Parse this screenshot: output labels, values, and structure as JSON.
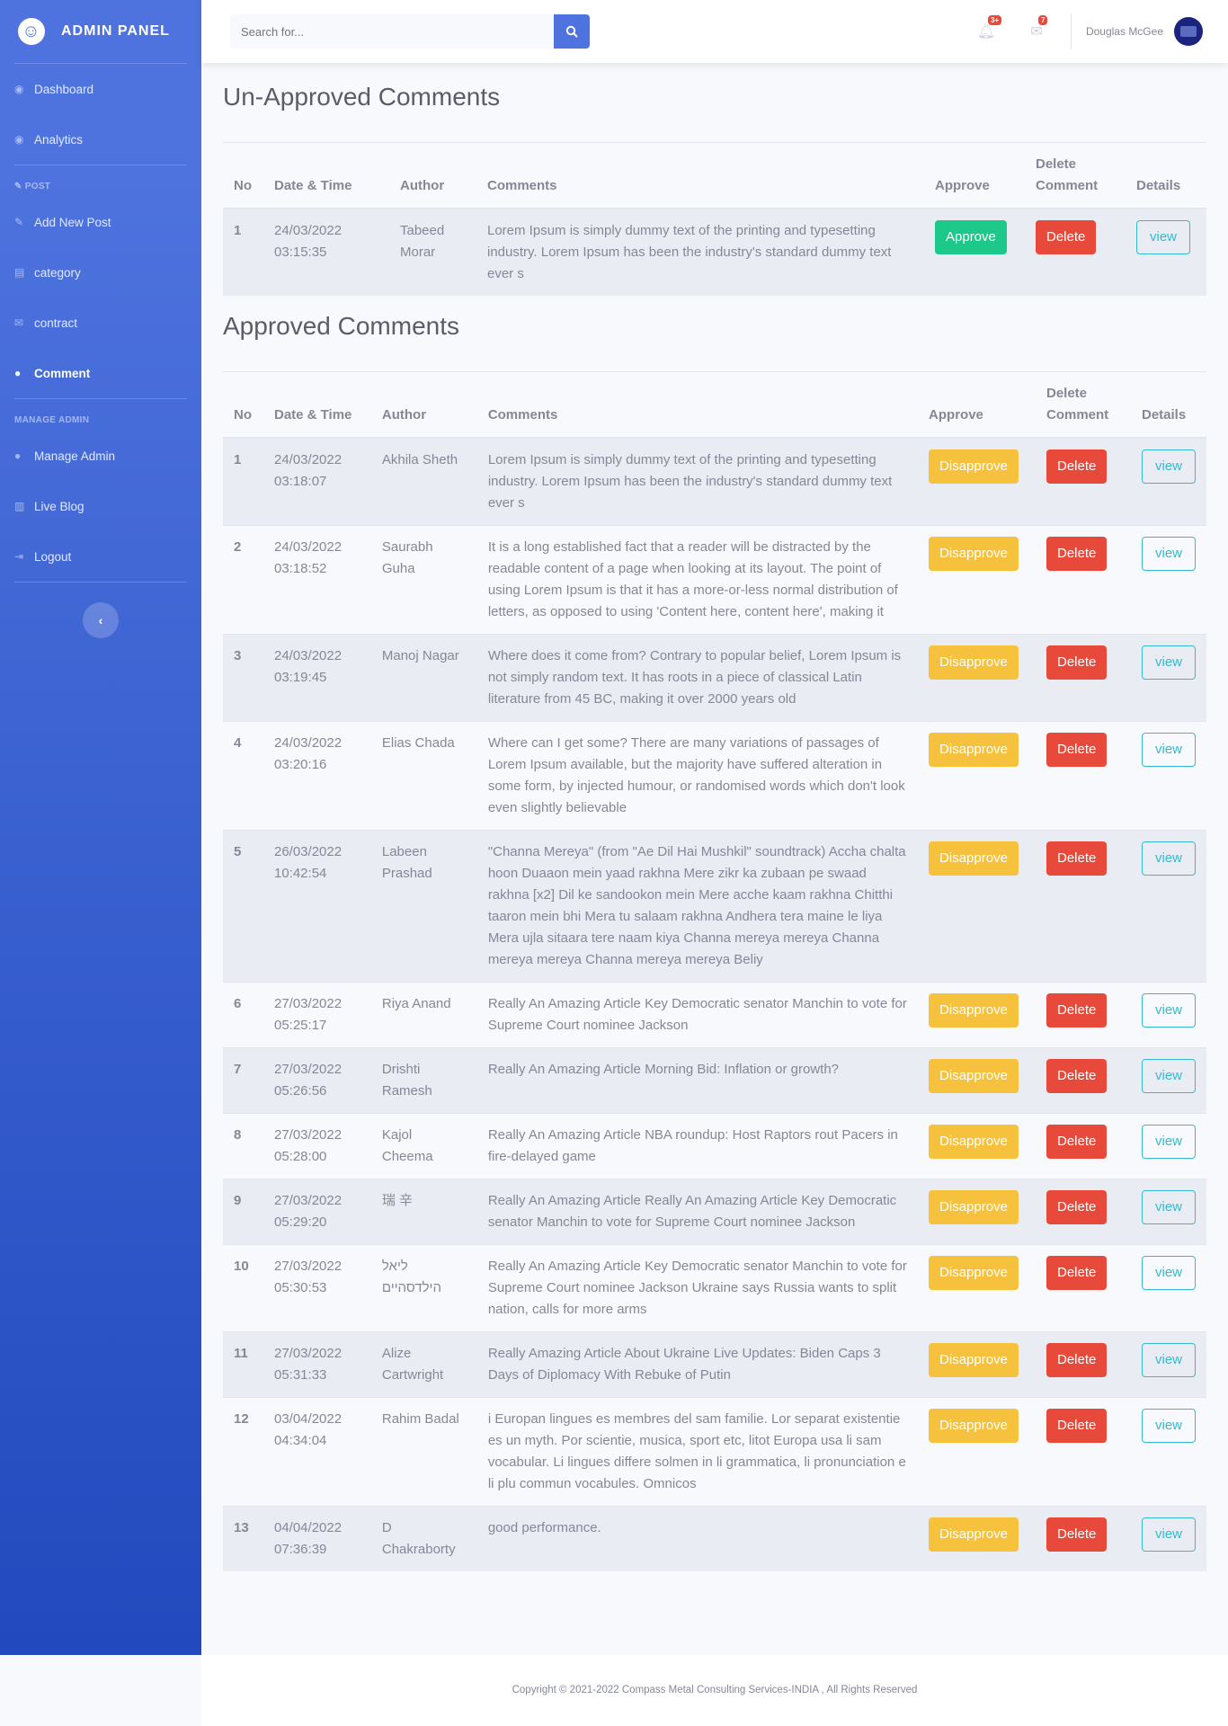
{
  "brand": {
    "title": "ADMIN PANEL"
  },
  "sidebar": {
    "items_top": [
      {
        "label": "Dashboard",
        "icon": "dashboard-icon"
      },
      {
        "label": "Analytics",
        "icon": "analytics-icon"
      }
    ],
    "heading_post": "POST",
    "items_post": [
      {
        "label": "Add New Post",
        "icon": "pen-icon"
      },
      {
        "label": "category",
        "icon": "list-icon"
      },
      {
        "label": "contract",
        "icon": "envelope-icon"
      },
      {
        "label": "Comment",
        "icon": "comment-icon"
      }
    ],
    "heading_admin": "MANAGE ADMIN",
    "items_admin": [
      {
        "label": "Manage Admin",
        "icon": "user-icon"
      },
      {
        "label": "Live Blog",
        "icon": "chart-icon"
      },
      {
        "label": "Logout",
        "icon": "logout-icon"
      }
    ],
    "active": "Comment"
  },
  "topbar": {
    "search_placeholder": "Search for...",
    "alerts_count": "3+",
    "messages_count": "7",
    "user_name": "Douglas McGee"
  },
  "unapproved": {
    "title": "Un-Approved Comments",
    "headers": {
      "no": "No",
      "date": "Date & Time",
      "author": "Author",
      "comments": "Comments",
      "approve": "Approve",
      "delete": "Delete Comment",
      "details": "Details"
    },
    "approve_label": "Approve",
    "delete_label": "Delete",
    "view_label": "view",
    "rows": [
      {
        "no": "1",
        "date": "24/03/2022 03:15:35",
        "author": "Tabeed Morar",
        "comment": "Lorem Ipsum is simply dummy text of the printing and typesetting industry. Lorem Ipsum has been the industry's standard dummy text ever s"
      }
    ]
  },
  "approved": {
    "title": "Approved Comments",
    "headers": {
      "no": "No",
      "date": "Date & Time",
      "author": "Author",
      "comments": "Comments",
      "approve": "Approve",
      "delete": "Delete Comment",
      "details": "Details"
    },
    "approve_label": "Disapprove",
    "delete_label": "Delete",
    "view_label": "view",
    "rows": [
      {
        "no": "1",
        "date": "24/03/2022 03:18:07",
        "author": "Akhila Sheth",
        "comment": "Lorem Ipsum is simply dummy text of the printing and typesetting industry. Lorem Ipsum has been the industry's standard dummy text ever s"
      },
      {
        "no": "2",
        "date": "24/03/2022 03:18:52",
        "author": "Saurabh Guha",
        "comment": "It is a long established fact that a reader will be distracted by the readable content of a page when looking at its layout. The point of using Lorem Ipsum is that it has a more-or-less normal distribution of letters, as opposed to using 'Content here, content here', making it"
      },
      {
        "no": "3",
        "date": "24/03/2022 03:19:45",
        "author": "Manoj Nagar",
        "comment": "Where does it come from? Contrary to popular belief, Lorem Ipsum is not simply random text. It has roots in a piece of classical Latin literature from 45 BC, making it over 2000 years old"
      },
      {
        "no": "4",
        "date": "24/03/2022 03:20:16",
        "author": "Elias Chada",
        "comment": "Where can I get some? There are many variations of passages of Lorem Ipsum available, but the majority have suffered alteration in some form, by injected humour, or randomised words which don't look even slightly believable"
      },
      {
        "no": "5",
        "date": "26/03/2022 10:42:54",
        "author": "Labeen Prashad",
        "comment": "\"Channa Mereya\" (from \"Ae Dil Hai Mushkil\" soundtrack) Accha chalta hoon Duaaon mein yaad rakhna Mere zikr ka zubaan pe swaad rakhna [x2] Dil ke sandookon mein Mere acche kaam rakhna Chitthi taaron mein bhi Mera tu salaam rakhna Andhera tera maine le liya Mera ujla sitaara tere naam kiya Channa mereya mereya Channa mereya mereya Channa mereya mereya Beliy"
      },
      {
        "no": "6",
        "date": "27/03/2022 05:25:17",
        "author": "Riya Anand",
        "comment": "Really An Amazing Article Key Democratic senator Manchin to vote for Supreme Court nominee Jackson"
      },
      {
        "no": "7",
        "date": "27/03/2022 05:26:56",
        "author": "Drishti Ramesh",
        "comment": "Really An Amazing Article Morning Bid: Inflation or growth?"
      },
      {
        "no": "8",
        "date": "27/03/2022 05:28:00",
        "author": "Kajol Cheema",
        "comment": "Really An Amazing Article NBA roundup: Host Raptors rout Pacers in fire-delayed game"
      },
      {
        "no": "9",
        "date": "27/03/2022 05:29:20",
        "author": "瑞 辛",
        "comment": "Really An Amazing Article Really An Amazing Article Key Democratic senator Manchin to vote for Supreme Court nominee Jackson"
      },
      {
        "no": "10",
        "date": "27/03/2022 05:30:53",
        "author": "ליאל הילדסהיים",
        "comment": "Really An Amazing Article Key Democratic senator Manchin to vote for Supreme Court nominee Jackson Ukraine says Russia wants to split nation, calls for more arms"
      },
      {
        "no": "11",
        "date": "27/03/2022 05:31:33",
        "author": "Alize Cartwright",
        "comment": "Really Amazing Article About Ukraine Live Updates: Biden Caps 3 Days of Diplomacy With Rebuke of Putin"
      },
      {
        "no": "12",
        "date": "03/04/2022 04:34:04",
        "author": "Rahim Badal",
        "comment": "i Europan lingues es membres del sam familie. Lor separat existentie es un myth. Por scientie, musica, sport etc, litot Europa usa li sam vocabular. Li lingues differe solmen in li grammatica, li pronunciation e li plu commun vocabules. Omnicos"
      },
      {
        "no": "13",
        "date": "04/04/2022 07:36:39",
        "author": "D Chakraborty",
        "comment": "good performance."
      }
    ]
  },
  "footer": {
    "text": "Copyright © 2021-2022 Compass Metal Consulting Services-INDIA , All Rights Reserved"
  }
}
